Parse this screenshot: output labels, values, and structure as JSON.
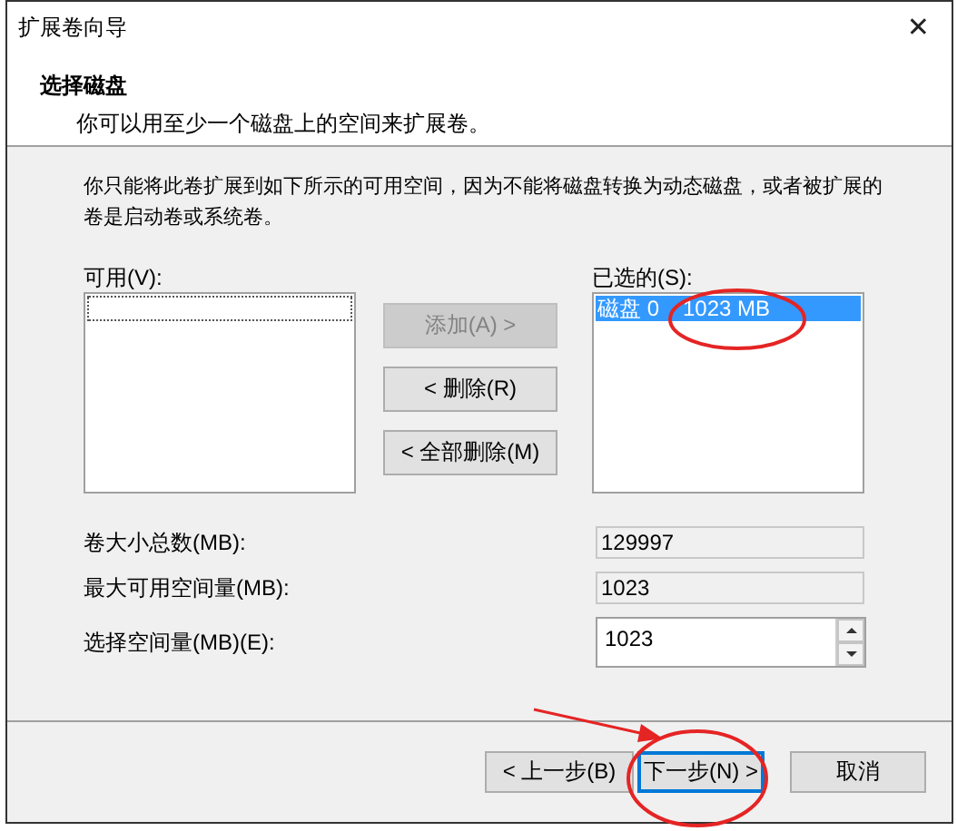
{
  "window": {
    "title": "扩展卷向导",
    "close": "✕"
  },
  "header": {
    "title": "选择磁盘",
    "subtitle": "你可以用至少一个磁盘上的空间来扩展卷。"
  },
  "description": "你只能将此卷扩展到如下所示的可用空间，因为不能将磁盘转换为动态磁盘，或者被扩展的卷是启动卷或系统卷。",
  "available": {
    "label": "可用(V):"
  },
  "transfer_buttons": [
    {
      "label": "添加(A) >",
      "disabled": true
    },
    {
      "label": "< 删除(R)",
      "disabled": false
    },
    {
      "label": "< 全部删除(M)",
      "disabled": false
    }
  ],
  "selected": {
    "label": "已选的(S):",
    "items": [
      {
        "disk": "磁盘 0",
        "size": "1023 MB",
        "selected": true
      }
    ]
  },
  "fields": [
    {
      "label": "卷大小总数(MB):",
      "value": "129997",
      "kind": "readonly"
    },
    {
      "label": "最大可用空间量(MB):",
      "value": "1023",
      "kind": "readonly"
    },
    {
      "label": "选择空间量(MB)(E):",
      "value": "1023",
      "kind": "spin"
    }
  ],
  "footer_buttons": [
    {
      "label": "< 上一步(B)",
      "default": false
    },
    {
      "label": "下一步(N) >",
      "default": true
    },
    {
      "label": "取消",
      "default": false
    }
  ],
  "annotations": [
    {
      "kind": "ellipse"
    },
    {
      "kind": "arrow"
    },
    {
      "kind": "ellipse"
    }
  ]
}
